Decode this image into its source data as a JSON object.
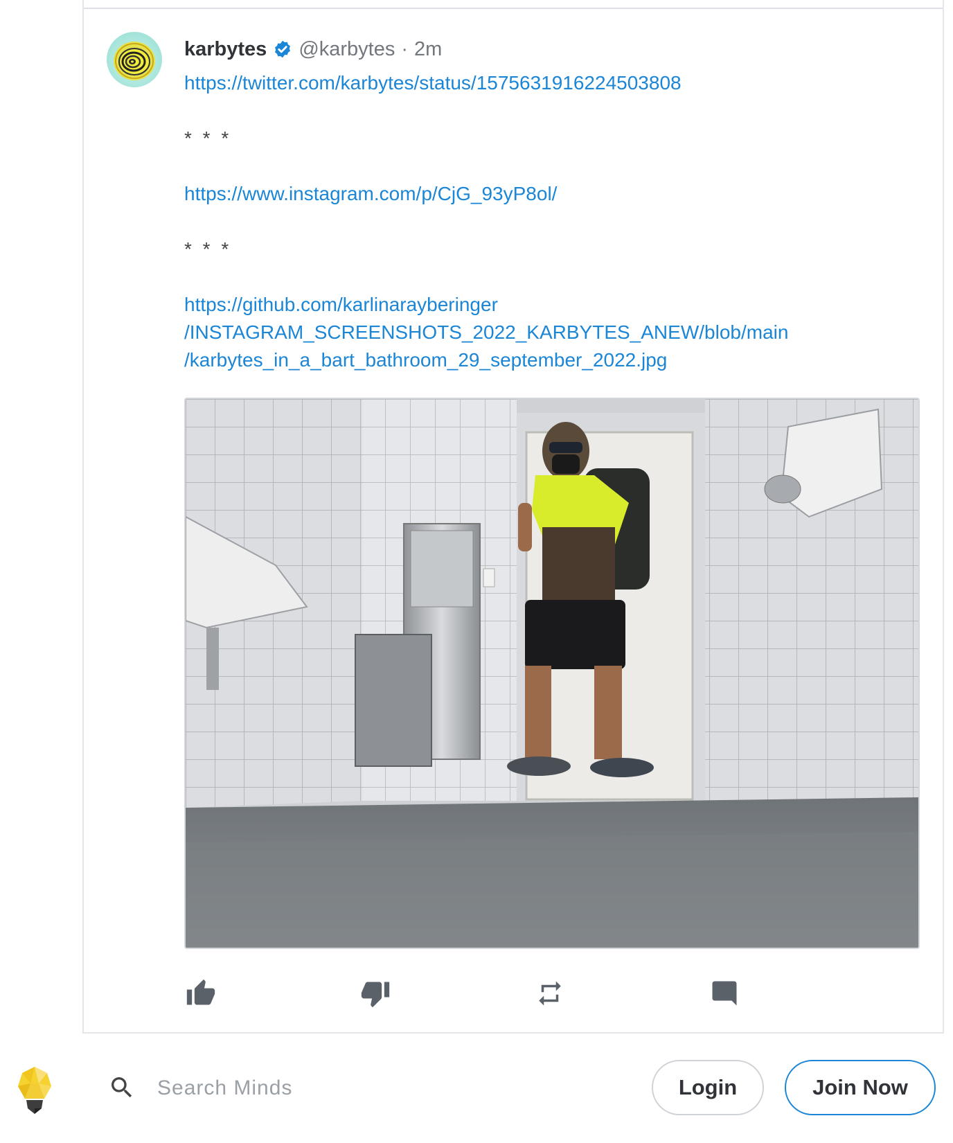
{
  "post": {
    "author_name": "karbytes",
    "author_handle": "@karbytes",
    "separator_dot": "·",
    "time_ago": "2m",
    "link_twitter": "https://twitter.com/karbytes/status/1575631916224503808",
    "separator_1": "* * *",
    "link_instagram": "https://www.instagram.com/p/CjG_93yP8ol/",
    "separator_2": "* * *",
    "link_github_line1": "https://github.com/karlinarayberinger",
    "link_github_line2": "/INSTAGRAM_SCREENSHOTS_2022_KARBYTES_ANEW/blob/main",
    "link_github_line3": "/karbytes_in_a_bart_bathroom_29_september_2022.jpg"
  },
  "icons": {
    "like": "thumb-up-icon",
    "dislike": "thumb-down-icon",
    "remind": "repeat-icon",
    "comment": "comment-icon",
    "search": "search-icon",
    "logo": "minds-bulb-logo"
  },
  "bottom_bar": {
    "search_placeholder": "Search Minds",
    "login_label": "Login",
    "join_label": "Join Now"
  },
  "colors": {
    "link": "#1b85d6",
    "verified": "#1b85d6",
    "icon_gray": "#5b6169"
  }
}
